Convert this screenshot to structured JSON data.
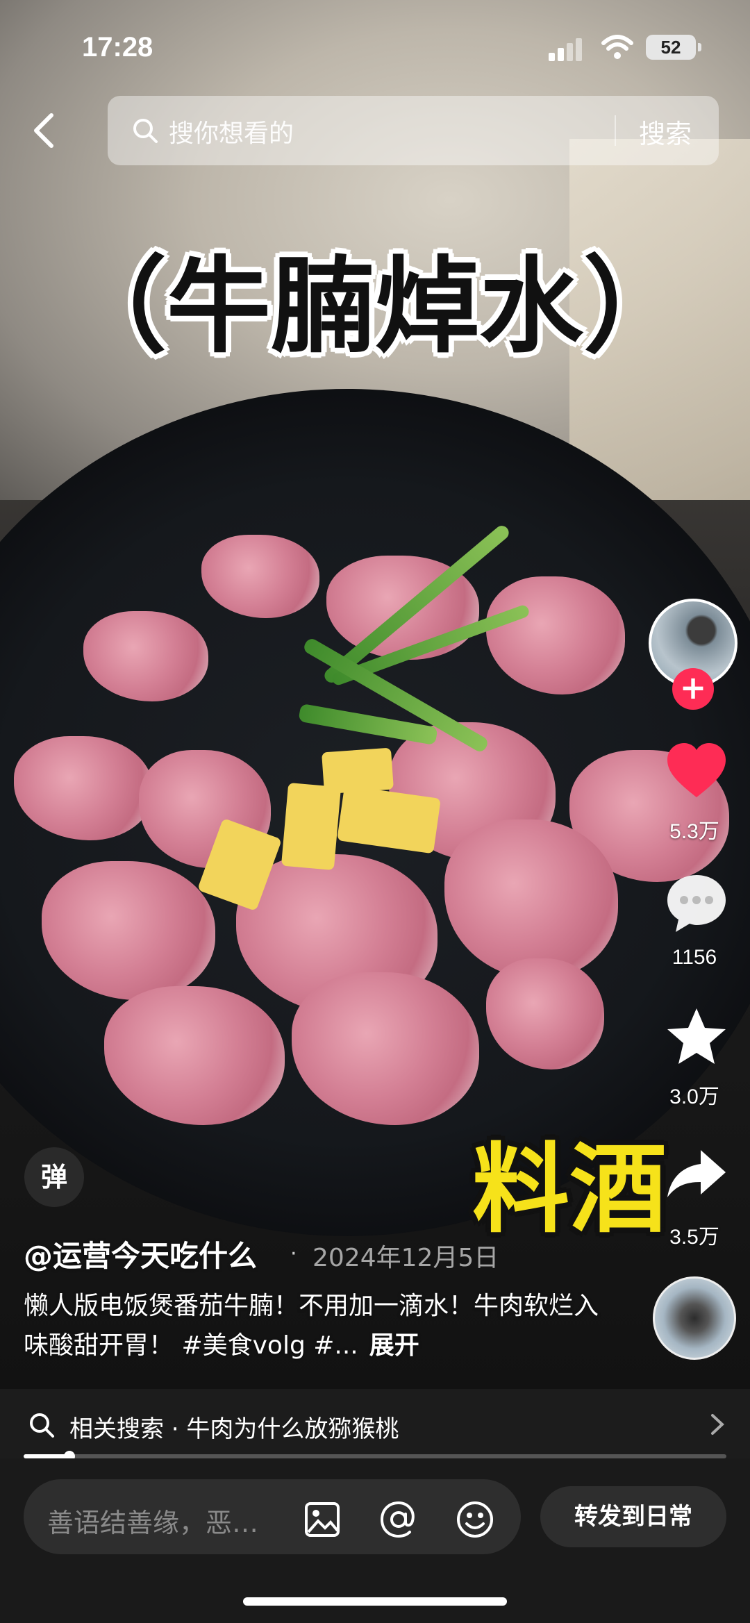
{
  "status_bar": {
    "time": "17:28",
    "battery": "52"
  },
  "search": {
    "placeholder": "搜你想看的",
    "button": "搜索"
  },
  "video": {
    "overlay_title": "（牛腩焯水）",
    "overlay_tag": "料酒"
  },
  "actions": {
    "likes": "5.3万",
    "comments": "1156",
    "favorites": "3.0万",
    "shares": "3.5万"
  },
  "danmaku_label": "弹",
  "post": {
    "author": "@运营今天吃什么",
    "separator": "·",
    "date": "2024年12月5日",
    "description": "懒人版电饭煲番茄牛腩！不用加一滴水！牛肉软烂入味酸甜开胃！ #美食volg #...",
    "expand": "展开"
  },
  "related_search": {
    "text": "相关搜索 · 牛肉为什么放猕猴桃"
  },
  "progress": {
    "played_fraction": 0.065
  },
  "bottom_bar": {
    "comment_placeholder": "善语结善缘，恶…",
    "share_daily": "转发到日常"
  },
  "colors": {
    "like": "#fe2c55",
    "overlay_tag": "#f6e21a"
  },
  "icons": [
    "back-arrow-icon",
    "search-icon",
    "heart-icon",
    "comment-bubble-icon",
    "star-icon",
    "share-arrow-icon",
    "image-icon",
    "at-icon",
    "emoji-icon",
    "chevron-right-icon"
  ]
}
